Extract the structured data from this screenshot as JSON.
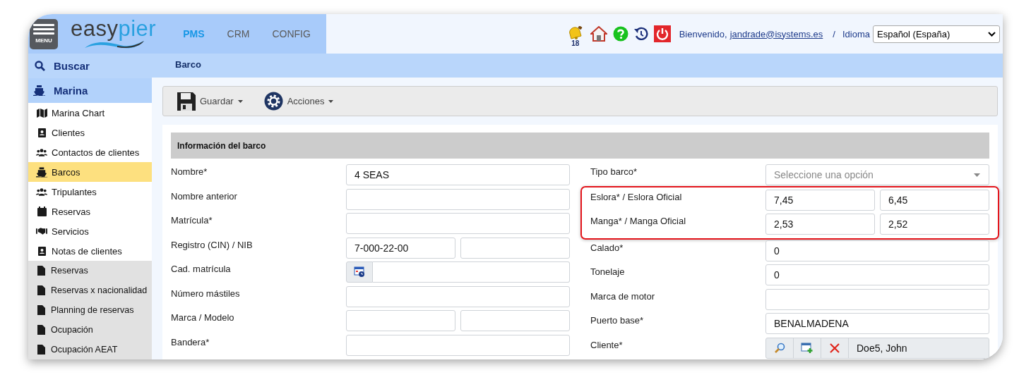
{
  "header": {
    "menu_label": "MENU",
    "logo": [
      "easy",
      "pier"
    ],
    "tabs": [
      {
        "label": "PMS",
        "selected": true
      },
      {
        "label": "CRM",
        "selected": false
      },
      {
        "label": "CONFIG",
        "selected": false
      }
    ],
    "notifications": "18",
    "welcome": "Bienvenido,",
    "user": "jandrade@isystems.es",
    "separator": "/",
    "language_label": "Idioma",
    "language": "Español (España)"
  },
  "sidebar": {
    "search": "Buscar",
    "section": "Marina",
    "items": [
      {
        "label": "Marina Chart",
        "kind": "module",
        "selected": false
      },
      {
        "label": "Clientes",
        "kind": "module",
        "selected": false
      },
      {
        "label": "Contactos de clientes",
        "kind": "module",
        "selected": false
      },
      {
        "label": "Barcos",
        "kind": "module",
        "selected": true
      },
      {
        "label": "Tripulantes",
        "kind": "module",
        "selected": false
      },
      {
        "label": "Reservas",
        "kind": "module",
        "selected": false
      },
      {
        "label": "Servicios",
        "kind": "module",
        "selected": false
      },
      {
        "label": "Notas de clientes",
        "kind": "module",
        "selected": false
      },
      {
        "label": "Reservas",
        "kind": "report",
        "selected": false
      },
      {
        "label": "Reservas x nacionalidad",
        "kind": "report",
        "selected": false
      },
      {
        "label": "Planning de reservas",
        "kind": "report",
        "selected": false
      },
      {
        "label": "Ocupación",
        "kind": "report",
        "selected": false
      },
      {
        "label": "Ocupación AEAT",
        "kind": "report",
        "selected": false
      }
    ]
  },
  "breadcrumb": "Barco",
  "toolbar": [
    {
      "label": "Guardar"
    },
    {
      "label": "Acciones"
    }
  ],
  "form": {
    "title": "Información del barco",
    "left": [
      {
        "label": "Nombre*",
        "fields": [
          {
            "kind": "text",
            "value": "4 SEAS"
          }
        ]
      },
      {
        "label": "Nombre anterior",
        "fields": [
          {
            "kind": "text"
          }
        ]
      },
      {
        "label": "Matrícula*",
        "fields": [
          {
            "kind": "text"
          }
        ]
      },
      {
        "label": "Registro (CIN) / NIB",
        "fields": [
          {
            "kind": "text",
            "value": "7-000-22-00"
          },
          {
            "kind": "text"
          }
        ]
      },
      {
        "label": "Cad. matrícula",
        "fields": [
          {
            "kind": "date"
          }
        ]
      },
      {
        "label": "Número mástiles",
        "fields": [
          {
            "kind": "text"
          }
        ]
      },
      {
        "label": "Marca / Modelo",
        "fields": [
          {
            "kind": "text"
          },
          {
            "kind": "text"
          }
        ]
      },
      {
        "label": "Bandera*",
        "fields": [
          {
            "kind": "text"
          }
        ]
      }
    ],
    "right": [
      {
        "label": "Tipo barco*",
        "highlighted": false,
        "fields": [
          {
            "kind": "select",
            "placeholder": "Seleccione una opción"
          }
        ]
      },
      {
        "label": "Eslora* / Eslora Oficial",
        "highlighted": true,
        "fields": [
          {
            "kind": "text",
            "value": "7,45"
          },
          {
            "kind": "text",
            "value": "6,45"
          }
        ]
      },
      {
        "label": "Manga* / Manga Oficial",
        "highlighted": true,
        "fields": [
          {
            "kind": "text",
            "value": "2,53"
          },
          {
            "kind": "text",
            "value": "2,52"
          }
        ]
      },
      {
        "label": "Calado*",
        "highlighted": false,
        "fields": [
          {
            "kind": "text",
            "value": "0"
          }
        ]
      },
      {
        "label": "Tonelaje",
        "highlighted": false,
        "fields": [
          {
            "kind": "text",
            "value": "0"
          }
        ]
      },
      {
        "label": "Marca de motor",
        "highlighted": false,
        "fields": [
          {
            "kind": "text"
          }
        ]
      },
      {
        "label": "Puerto base*",
        "highlighted": false,
        "fields": [
          {
            "kind": "text",
            "value": "BENALMADENA"
          }
        ]
      },
      {
        "label": "Cliente*",
        "highlighted": false,
        "fields": [
          {
            "kind": "lookup",
            "value": "Doe5, John"
          }
        ]
      }
    ]
  }
}
